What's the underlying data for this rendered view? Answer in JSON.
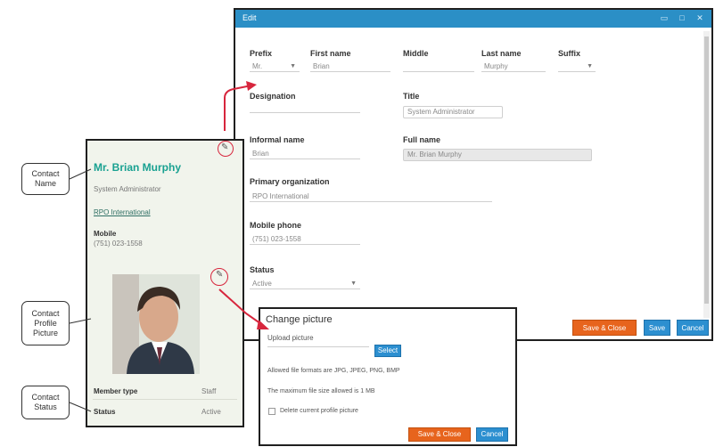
{
  "edit_dialog": {
    "title": "Edit",
    "window_buttons": [
      "▭",
      "□",
      "✕"
    ],
    "labels": {
      "prefix": "Prefix",
      "first_name": "First name",
      "middle": "Middle",
      "last_name": "Last name",
      "suffix": "Suffix",
      "designation": "Designation",
      "title": "Title",
      "informal_name": "Informal name",
      "full_name": "Full name",
      "primary_org": "Primary organization",
      "mobile_phone": "Mobile phone",
      "status": "Status"
    },
    "values": {
      "prefix": "Mr.",
      "first_name": "Brian",
      "middle": "",
      "last_name": "Murphy",
      "suffix": "",
      "designation": "",
      "title": "System Administrator",
      "informal_name": "Brian",
      "full_name": "Mr. Brian Murphy",
      "primary_org": "RPO International",
      "mobile_phone": "(751) 023-1558",
      "status": "Active"
    },
    "buttons": {
      "save_close": "Save & Close",
      "save": "Save",
      "cancel": "Cancel"
    }
  },
  "contact_card": {
    "name": "Mr. Brian Murphy",
    "job_title": "System Administrator",
    "organization": "RPO International",
    "mobile_label": "Mobile",
    "mobile_value": "(751) 023-1558",
    "member_type_label": "Member type",
    "member_type_value": "Staff",
    "status_label": "Status",
    "status_value": "Active"
  },
  "picture_dialog": {
    "title": "Change picture",
    "upload_label": "Upload picture",
    "select_button": "Select",
    "allowed_text": "Allowed file formats are JPG, JPEG, PNG, BMP",
    "max_size_text": "The maximum file size allowed is 1 MB",
    "delete_checkbox_label": "Delete current profile picture",
    "save_close_button": "Save & Close",
    "cancel_button": "Cancel"
  },
  "callouts": {
    "contact_name": "Contact\nName",
    "contact_picture": "Contact\nProfile\nPicture",
    "contact_status": "Contact\nStatus"
  },
  "colors": {
    "title_bar": "#2b8fc6",
    "accent_teal": "#19a191",
    "save_orange": "#e7641d",
    "button_blue": "#2c8fd0",
    "arrow_red": "#d7263d"
  }
}
